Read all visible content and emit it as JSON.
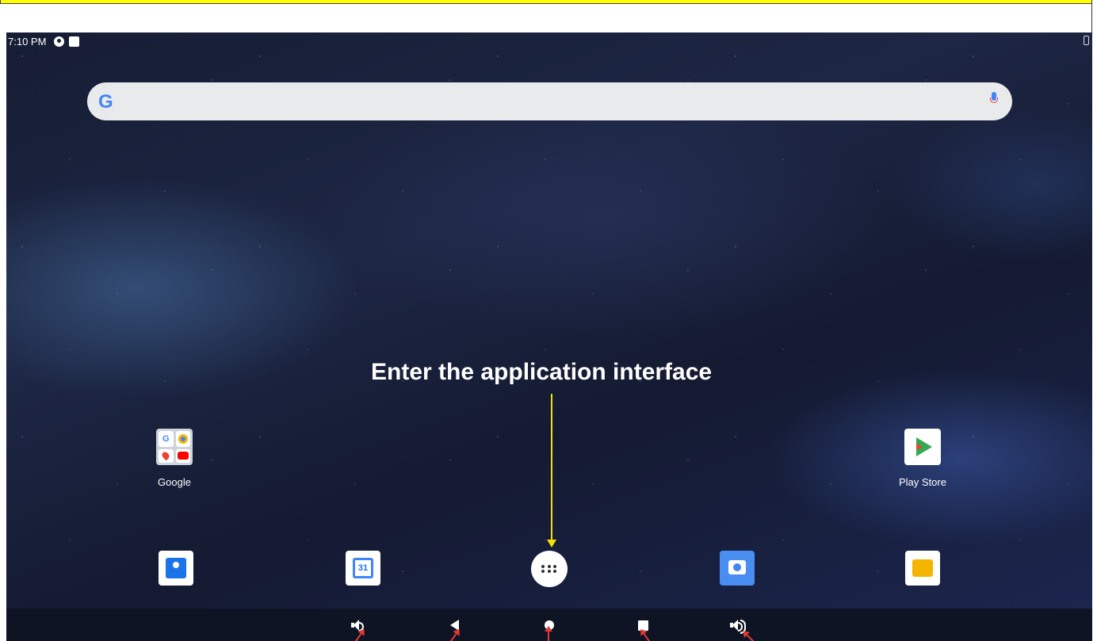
{
  "status_bar": {
    "time": "7:10 PM"
  },
  "search": {
    "logo_letter": "G"
  },
  "annotation": {
    "text": "Enter the application interface"
  },
  "home_apps": [
    {
      "label": "Google"
    },
    {
      "label": "Play Store"
    }
  ],
  "dock": {
    "calendar_date": "31"
  },
  "nav_bar": {
    "buttons": [
      "volume-down",
      "back",
      "home",
      "recents",
      "volume-up"
    ]
  },
  "colors": {
    "banner": "#ffff00",
    "annotation_arrow": "#f5e000",
    "callout_arrows": "#e53935",
    "google_blue": "#4285f4"
  }
}
